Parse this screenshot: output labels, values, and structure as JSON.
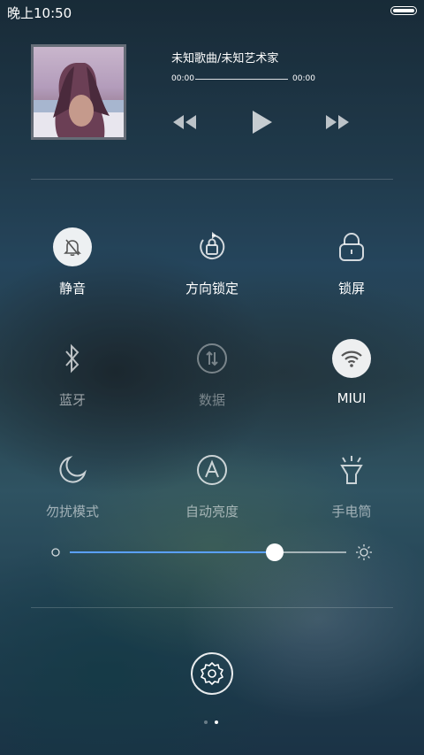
{
  "status_bar": {
    "time": "晚上10:50",
    "battery_level": 1.0
  },
  "music": {
    "title": "未知歌曲/未知艺术家",
    "time_elapsed": "00:00",
    "time_total": "00:00",
    "progress": 0
  },
  "toggles": [
    {
      "label": "静音",
      "icon": "mute-bell-icon",
      "on": true
    },
    {
      "label": "方向锁定",
      "icon": "rotation-lock-icon",
      "on": false
    },
    {
      "label": "锁屏",
      "icon": "lock-icon",
      "on": false
    },
    {
      "label": "蓝牙",
      "icon": "bluetooth-icon",
      "on": false
    },
    {
      "label": "数据",
      "icon": "mobile-data-icon",
      "on": false,
      "disabled": true
    },
    {
      "label": "MIUI",
      "icon": "wifi-icon",
      "on": true
    },
    {
      "label": "勿扰模式",
      "icon": "moon-icon",
      "on": false
    },
    {
      "label": "自动亮度",
      "icon": "auto-brightness-icon",
      "on": false
    },
    {
      "label": "手电筒",
      "icon": "flashlight-icon",
      "on": false
    }
  ],
  "brightness": {
    "level": 0.74
  },
  "pager": {
    "pages": 2,
    "current": 2
  },
  "colors": {
    "accent": "#5aa0ff",
    "on_circle": "#ffffff"
  }
}
